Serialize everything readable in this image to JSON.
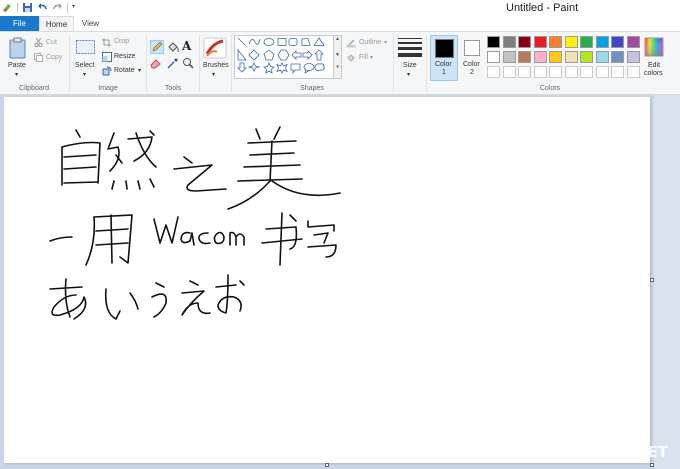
{
  "window": {
    "title": "Untitled - Paint"
  },
  "tabs": [
    {
      "label": "File"
    },
    {
      "label": "Home"
    },
    {
      "label": "View"
    }
  ],
  "clipboard": {
    "paste": "Paste",
    "cut": "Cut",
    "copy": "Copy",
    "group": "Clipboard"
  },
  "image": {
    "select": "Select",
    "crop": "Crop",
    "resize": "Resize",
    "rotate": "Rotate",
    "group": "Image"
  },
  "tools": {
    "group": "Tools"
  },
  "brushes": {
    "label": "Brushes"
  },
  "shapes": {
    "outline": "Outline",
    "fill": "Fill",
    "group": "Shapes"
  },
  "size": {
    "label": "Size"
  },
  "colors": {
    "color1": "Color\n1",
    "color1_line1": "Color",
    "color1_line2": "1",
    "color2_line1": "Color",
    "color2_line2": "2",
    "edit_line1": "Edit",
    "edit_line2": "colors",
    "group": "Colors",
    "row1": [
      "#000000",
      "#7f7f7f",
      "#880015",
      "#ed1c24",
      "#ff7f27",
      "#fff200",
      "#22b14c",
      "#00a2e8",
      "#3f48cc",
      "#a349a4"
    ],
    "row2": [
      "#ffffff",
      "#c3c3c3",
      "#b97a57",
      "#ffaec9",
      "#ffc90e",
      "#efe4b0",
      "#b5e61d",
      "#99d9ea",
      "#7092be",
      "#c8bfe7"
    ],
    "selected_color1": "#000000",
    "selected_color2": "#ffffff"
  },
  "canvas": {
    "line1": "自然之美",
    "line2": "一用Wacom书写",
    "line3": "あいうえお"
  },
  "watermark": "SMYZ.NET"
}
